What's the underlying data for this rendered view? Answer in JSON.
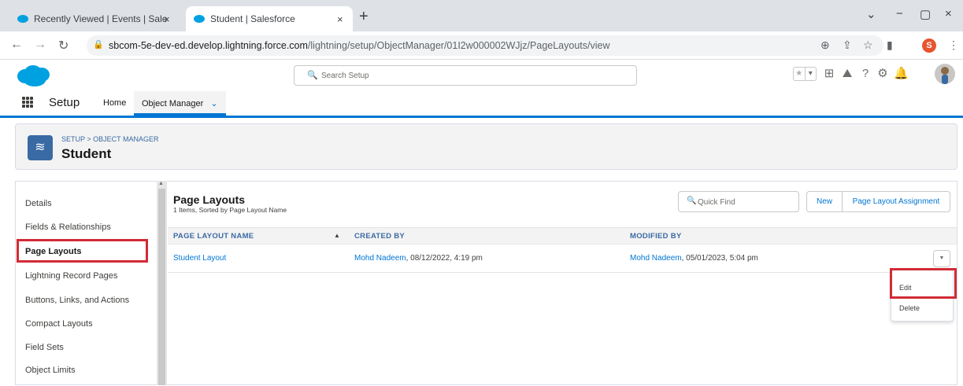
{
  "browser": {
    "tabs": [
      {
        "title": "Recently Viewed | Events | Salesf",
        "close": "×"
      },
      {
        "title": "Student | Salesforce",
        "close": "×"
      }
    ],
    "new_tab": "+",
    "window_controls": {
      "dropdown": "⌄",
      "minimize": "−",
      "maximize": "▢",
      "close": "×"
    },
    "url_host": "sbcom-5e-dev-ed.develop.lightning.force.com",
    "url_path": "/lightning/setup/ObjectManager/01I2w000002WJjz/PageLayouts/view",
    "profile_initial": "S"
  },
  "header": {
    "search_placeholder": "Search Setup",
    "icons": [
      "favorites-star-icon",
      "favorites-dropdown-icon",
      "add-icon",
      "trailhead-icon",
      "help-icon",
      "settings-gear-icon",
      "notifications-bell-icon",
      "user-avatar"
    ]
  },
  "appnav": {
    "app_name": "Setup",
    "home": "Home",
    "object_manager": "Object Manager",
    "object_manager_chevron": "⌄"
  },
  "object_header": {
    "breadcrumb": "SETUP > OBJECT MANAGER",
    "title": "Student"
  },
  "sidebar": {
    "items": [
      {
        "label": "Details",
        "active": false
      },
      {
        "label": "Fields & Relationships",
        "active": false
      },
      {
        "label": "Page Layouts",
        "active": true
      },
      {
        "label": "Lightning Record Pages",
        "active": false
      },
      {
        "label": "Buttons, Links, and Actions",
        "active": false
      },
      {
        "label": "Compact Layouts",
        "active": false
      },
      {
        "label": "Field Sets",
        "active": false
      },
      {
        "label": "Object Limits",
        "active": false
      }
    ]
  },
  "main": {
    "title": "Page Layouts",
    "subtitle": "1 Items, Sorted by Page Layout Name",
    "quick_find_placeholder": "Quick Find",
    "new_button": "New",
    "assignment_button": "Page Layout Assignment",
    "columns": [
      "PAGE LAYOUT NAME",
      "CREATED BY",
      "MODIFIED BY"
    ],
    "sort_indicator": "▲",
    "rows": [
      {
        "name": "Student Layout",
        "created_by_user": "Mohd Nadeem",
        "created_by_date": ", 08/12/2022, 4:19 pm",
        "modified_by_user": "Mohd Nadeem",
        "modified_by_date": ", 05/01/2023, 5:04 pm"
      }
    ],
    "row_menu": [
      "Edit",
      "Delete"
    ]
  },
  "colors": {
    "brand_blue": "#0176d3",
    "object_icon": "#3a6aa3",
    "highlight_red": "#d12b36",
    "salesforce_cloud": "#00a1e0"
  }
}
